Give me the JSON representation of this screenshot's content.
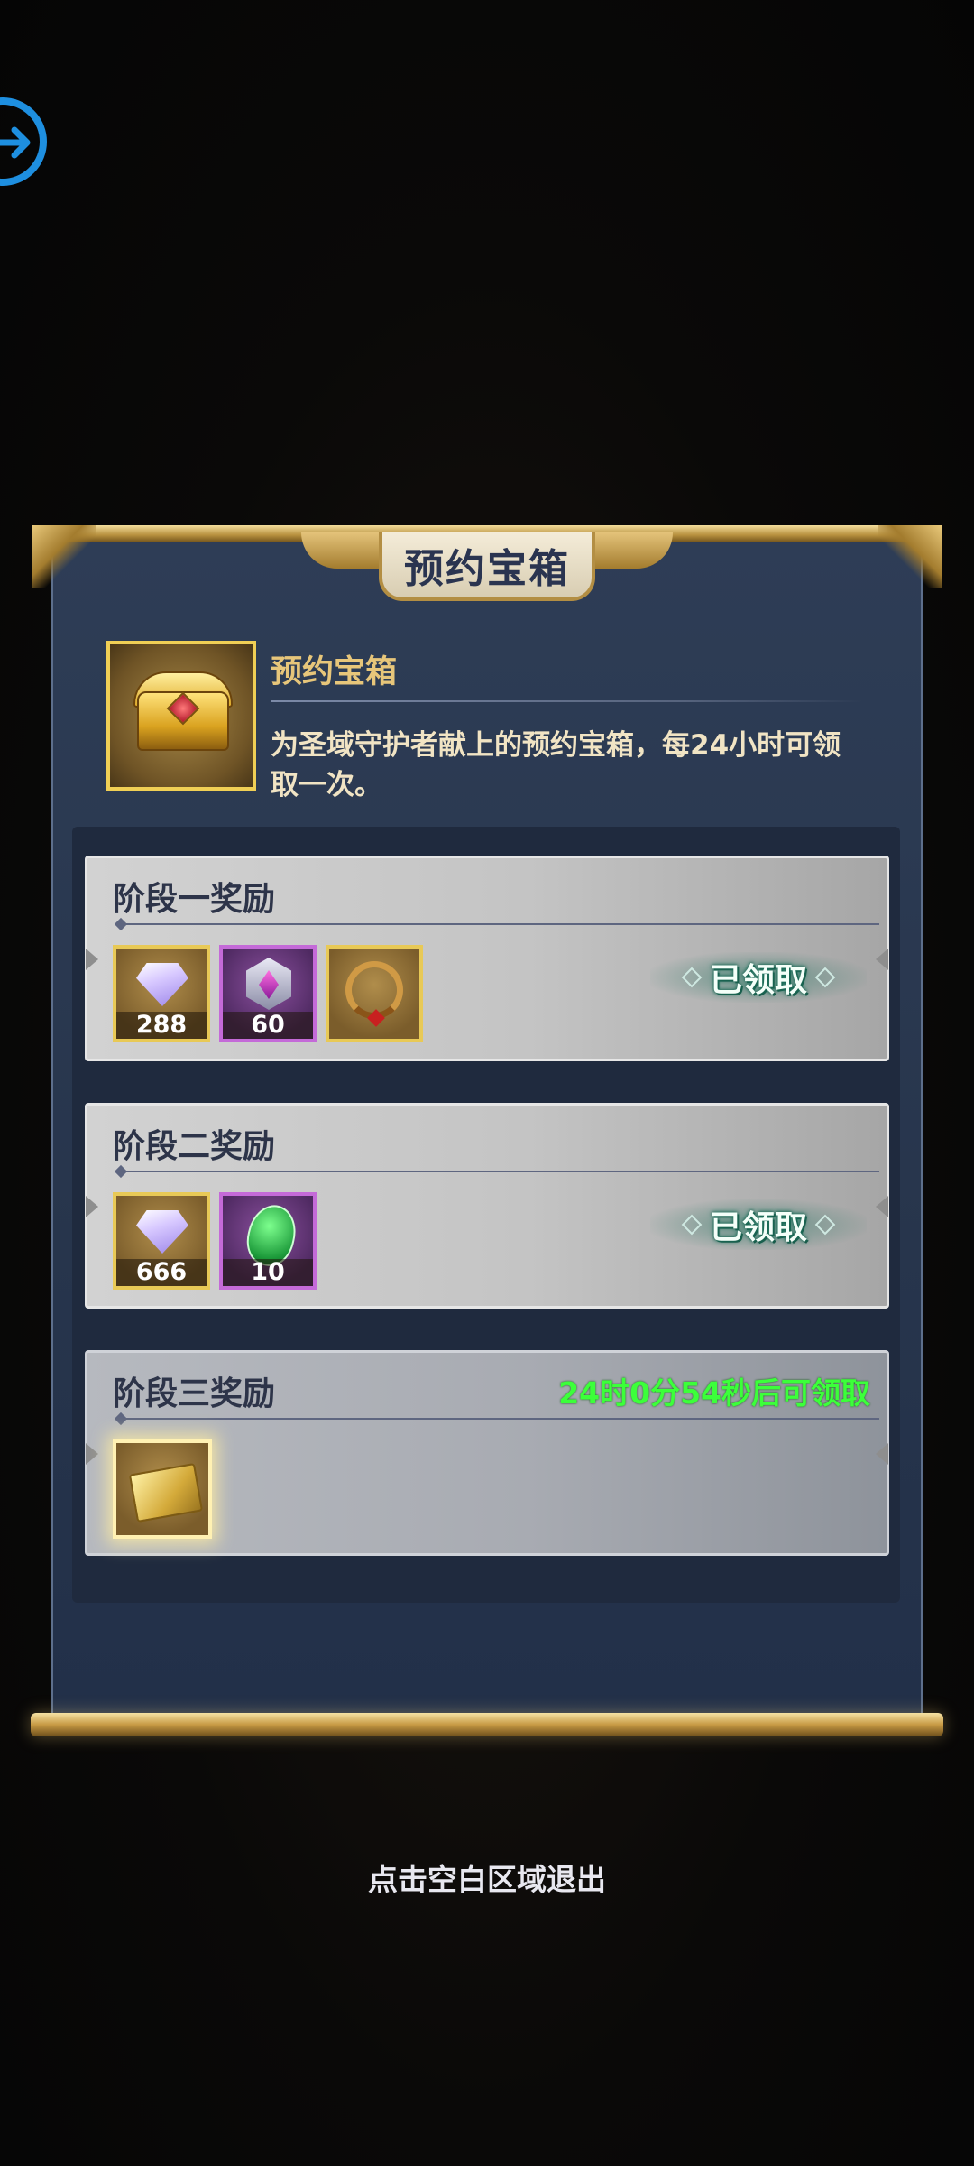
{
  "title": "预约宝箱",
  "chest": {
    "name": "预约宝箱",
    "description": "为圣域守护者献上的预约宝箱，每24小时可领取一次。"
  },
  "stages": [
    {
      "title": "阶段一奖励",
      "status": "已领取",
      "items": [
        {
          "icon": "diamond-icon",
          "count": "288"
        },
        {
          "icon": "purple-gem-icon",
          "count": "60"
        },
        {
          "icon": "ring-icon",
          "count": ""
        }
      ]
    },
    {
      "title": "阶段二奖励",
      "status": "已领取",
      "items": [
        {
          "icon": "diamond-icon",
          "count": "666"
        },
        {
          "icon": "green-rune-icon",
          "count": "10"
        }
      ]
    },
    {
      "title": "阶段三奖励",
      "countdown": "24时0分54秒后可领取",
      "items": [
        {
          "icon": "gold-ticket-icon",
          "count": ""
        }
      ]
    }
  ],
  "hint": "点击空白区域退出",
  "colors": {
    "panel": "#2a3850",
    "gold_border": "#e8c956",
    "countdown": "#3cff3a",
    "claimed_glow": "#1f7a64"
  }
}
